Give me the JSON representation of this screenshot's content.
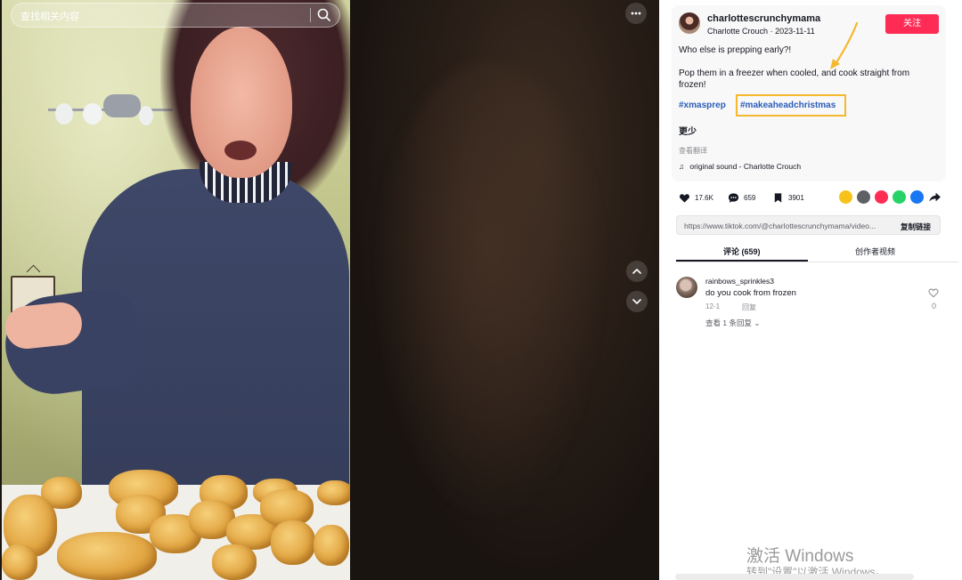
{
  "search": {
    "placeholder": "查找相关内容",
    "icon": "search-icon"
  },
  "video": {
    "more_icon": "more-horizontal-icon",
    "prev_icon": "chevron-up-icon",
    "next_icon": "chevron-down-icon"
  },
  "author": {
    "username": "charlottescrunchymama",
    "display_name": "Charlotte Crouch",
    "date": "2023-11-11",
    "follow_label": "关注"
  },
  "description": {
    "line1": "Who else is prepping early?!",
    "line2": "Pop them in a freezer when cooled, and cook straight from frozen!",
    "hashtags": [
      "#xmasprep",
      "#makeaheadchristmas"
    ],
    "more_label": "更少",
    "translate_label": "查看翻译",
    "music": "original sound - Charlotte Crouch"
  },
  "stats": {
    "likes": "17.6K",
    "comments": "659",
    "saves": "3901"
  },
  "share_colors": [
    "#f7c21a",
    "#5f6066",
    "#fe2c55",
    "#25d366",
    "#1877f2"
  ],
  "link": {
    "url": "https://www.tiktok.com/@charlottescrunchymama/video...",
    "copy_label": "复制链接"
  },
  "tabs": {
    "comments": "评论 (659)",
    "creator_videos": "创作者视频"
  },
  "comment": {
    "user": "rainbows_sprinkles3",
    "text": "do you cook from frozen",
    "date": "12-1",
    "reply_label": "回复",
    "view_replies": "查看 1 条回复",
    "likes": "0"
  },
  "watermark": {
    "line1": "激活 Windows",
    "line2": "转到\"设置\"以激活 Windows。"
  },
  "colors": {
    "accent": "#fe2c55",
    "hashtag": "#2b5db9",
    "highlight": "#f5b82e"
  }
}
